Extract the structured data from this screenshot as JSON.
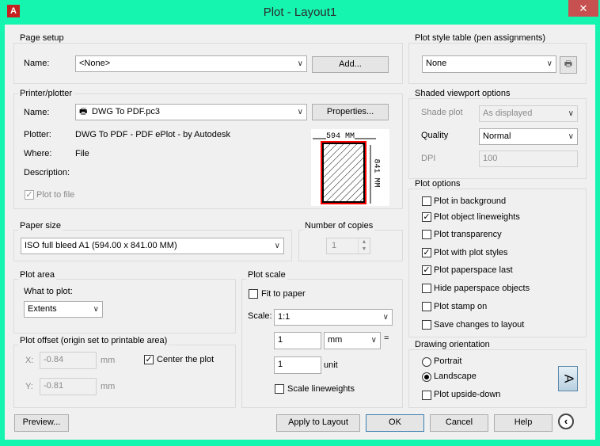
{
  "window": {
    "title": "Plot - Layout1",
    "close": "✕",
    "logo": "A"
  },
  "page_setup": {
    "label": "Page setup",
    "name_label": "Name:",
    "name_value": "<None>",
    "add_button": "Add..."
  },
  "printer": {
    "label": "Printer/plotter",
    "name_label": "Name:",
    "name_value": "DWG To PDF.pc3",
    "properties_button": "Properties...",
    "plotter_label": "Plotter:",
    "plotter_value": "DWG To PDF - PDF ePlot - by Autodesk",
    "where_label": "Where:",
    "where_value": "File",
    "description_label": "Description:",
    "plot_to_file": "Plot to file",
    "plot_to_file_checked": true,
    "preview_width": "594 MM",
    "preview_height": "841 MM"
  },
  "paper_size": {
    "label": "Paper size",
    "value": "ISO full bleed A1 (594.00 x 841.00 MM)"
  },
  "copies": {
    "label": "Number of copies",
    "value": "1"
  },
  "plot_area": {
    "label": "Plot area",
    "what_label": "What to plot:",
    "what_value": "Extents"
  },
  "plot_offset": {
    "label": "Plot offset (origin set to printable area)",
    "x_label": "X:",
    "x_value": "-0.84",
    "y_label": "Y:",
    "y_value": "-0.81",
    "unit": "mm",
    "center": "Center the plot",
    "center_checked": true
  },
  "plot_scale": {
    "label": "Plot scale",
    "fit": "Fit to paper",
    "fit_checked": false,
    "scale_label": "Scale:",
    "scale_value": "1:1",
    "value1": "1",
    "unit1": "mm",
    "equals": "=",
    "value2": "1",
    "unit2": "unit",
    "scale_lw": "Scale lineweights",
    "scale_lw_checked": false
  },
  "style_table": {
    "label": "Plot style table (pen assignments)",
    "value": "None"
  },
  "shaded": {
    "label": "Shaded viewport options",
    "shade_label": "Shade plot",
    "shade_value": "As displayed",
    "quality_label": "Quality",
    "quality_value": "Normal",
    "dpi_label": "DPI",
    "dpi_value": "100"
  },
  "plot_options": {
    "label": "Plot options",
    "items": [
      {
        "label": "Plot in background",
        "checked": false
      },
      {
        "label": "Plot object lineweights",
        "checked": true
      },
      {
        "label": "Plot transparency",
        "checked": false
      },
      {
        "label": "Plot with plot styles",
        "checked": true
      },
      {
        "label": "Plot paperspace last",
        "checked": true
      },
      {
        "label": "Hide paperspace objects",
        "checked": false
      },
      {
        "label": "Plot stamp on",
        "checked": false
      },
      {
        "label": "Save changes to layout",
        "checked": false
      }
    ]
  },
  "orientation": {
    "label": "Drawing orientation",
    "portrait": "Portrait",
    "landscape": "Landscape",
    "selected": "Landscape",
    "upside_down": "Plot upside-down",
    "icon_letter": "A"
  },
  "buttons": {
    "preview": "Preview...",
    "apply": "Apply to Layout",
    "ok": "OK",
    "cancel": "Cancel",
    "help": "Help"
  }
}
